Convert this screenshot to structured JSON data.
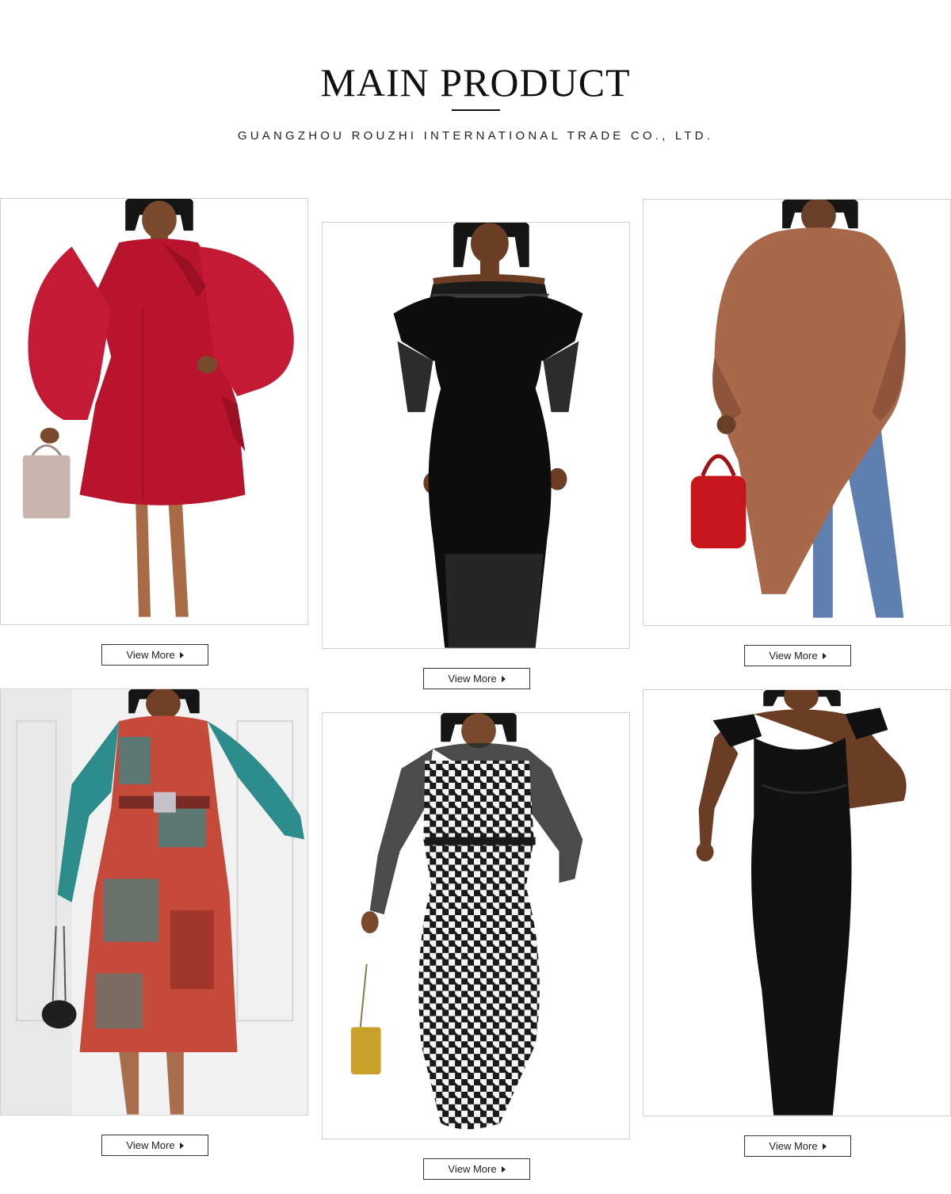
{
  "header": {
    "title": "MAIN PRODUCT",
    "subtitle": "GUANGZHOU ROUZHI INTERNATIONAL TRADE CO., LTD."
  },
  "products": [
    {
      "view_more_label": "View More",
      "dress_color": "#b8142e",
      "arrow_icon": "caret-right-icon"
    },
    {
      "view_more_label": "View More",
      "dress_color": "#0d0d0d",
      "arrow_icon": "caret-right-icon"
    },
    {
      "view_more_label": "View More",
      "dress_color": "#a8694a",
      "arrow_icon": "caret-right-icon"
    },
    {
      "view_more_label": "View More",
      "dress_color": "#2d8c8c",
      "arrow_icon": "caret-right-icon"
    },
    {
      "view_more_label": "View More",
      "dress_color": "#1a1a1a",
      "arrow_icon": "caret-right-icon"
    },
    {
      "view_more_label": "View More",
      "dress_color": "#111111",
      "arrow_icon": "caret-right-icon"
    }
  ]
}
